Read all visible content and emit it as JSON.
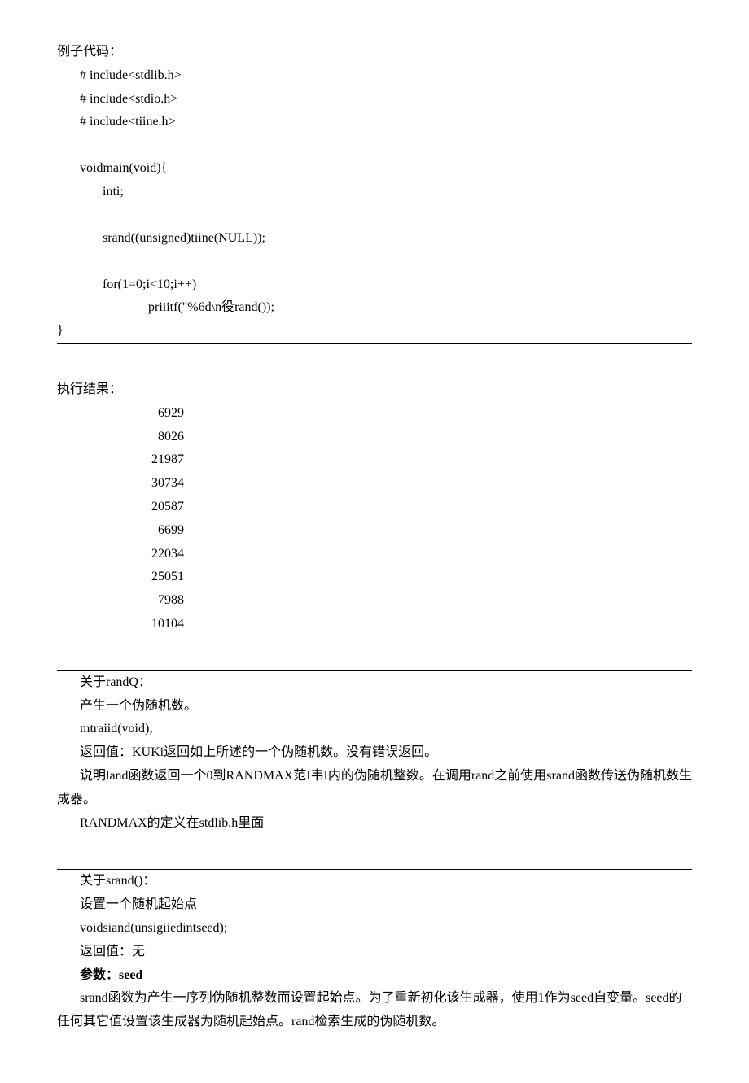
{
  "code_section": {
    "title": "例子代码：",
    "lines": [
      "#  include<stdlib.h>",
      "#  include<stdio.h>",
      "#  include<tiine.h>"
    ],
    "main_decl": "voidmain(void){",
    "body": [
      "inti;",
      "",
      "srand((unsigned)tiine(NULL));",
      "",
      "for(1=0;i<10;i++)"
    ],
    "printf_line": "priiitf(\"%6d\\n役rand());",
    "close_brace": "}"
  },
  "result_section": {
    "title": "执行结果：",
    "numbers": [
      "6929",
      "8026",
      "21987",
      "30734",
      "20587",
      "6699",
      "22034",
      "25051",
      "7988",
      "10104"
    ]
  },
  "rand_section": {
    "title": "关于randQ：",
    "desc": "产生一个伪随机数。",
    "sig": "mtraiid(void);",
    "return_val": "返回值：KUKi返回如上所述的一个伪随机数。没有错误返回。",
    "explanation": "说明land函数返回一个0到RANDMAX范I韦I内的伪随机整数。在调用rand之前使用srand函数传送伪随机数生成器。",
    "randmax": "RANDMAX的定义在stdlib.h里面"
  },
  "srand_section": {
    "title": "关于srand()：",
    "desc": "设置一个随机起始点",
    "sig": "voidsiand(unsigiiedintseed);",
    "return_val": "返回值：无",
    "params": "参数：seed",
    "explanation": "srand函数为产生一序列伪随机整数而设置起始点。为了重新初化该生成器，使用1作为seed自变量。seed的任何其它值设置该生成器为随机起始点。rand检索生成的伪随机数。"
  }
}
